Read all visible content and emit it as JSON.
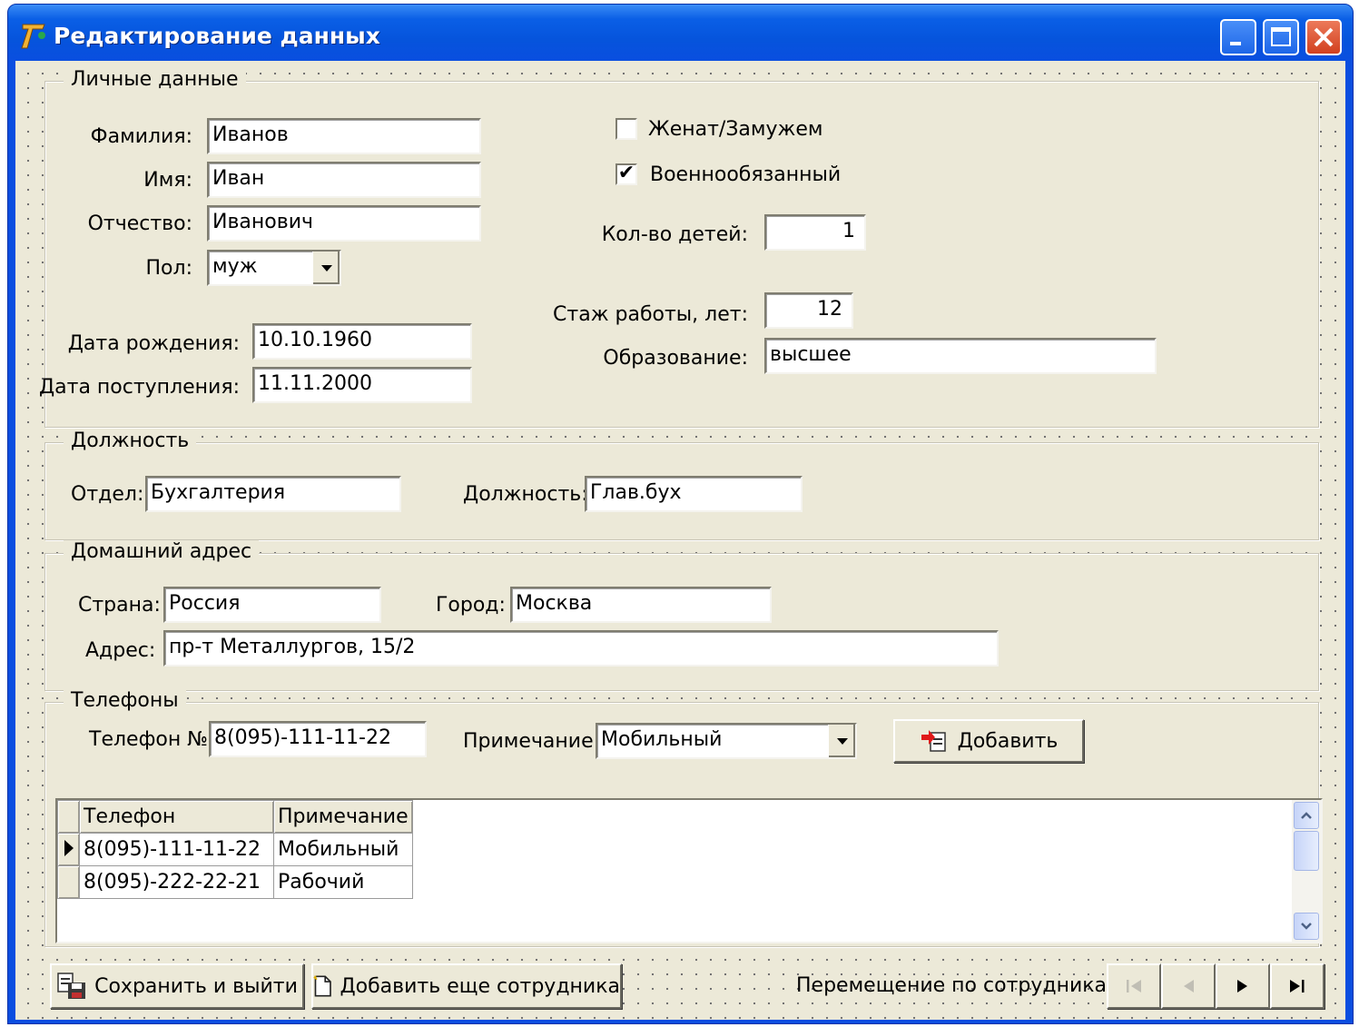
{
  "window": {
    "title": "Редактирование данных"
  },
  "personal": {
    "caption": "Личные данные",
    "last_name_label": "Фамилия:",
    "last_name": "Иванов",
    "first_name_label": "Имя:",
    "first_name": "Иван",
    "patronymic_label": "Отчество:",
    "patronymic": "Иванович",
    "sex_label": "Пол:",
    "sex": "муж",
    "birth_date_label": "Дата рождения:",
    "birth_date": "10.10.1960",
    "hire_date_label": "Дата поступления:",
    "hire_date": "11.11.2000",
    "married_label": "Женат/Замужем",
    "married_checked": false,
    "military_label": "Военнообязанный",
    "military_checked": true,
    "military_mark": "✔",
    "children_label": "Кол-во детей:",
    "children": "1",
    "experience_label": "Стаж работы, лет:",
    "experience": "12",
    "education_label": "Образование:",
    "education": "высшее"
  },
  "position": {
    "caption": "Должность",
    "department_label": "Отдел:",
    "department": "Бухгалтерия",
    "title_label": "Должность:",
    "title": "Глав.бух"
  },
  "address": {
    "caption": "Домашний адрес",
    "country_label": "Страна:",
    "country": "Россия",
    "city_label": "Город:",
    "city": "Москва",
    "street_label": "Адрес:",
    "street": "пр-т Металлургов, 15/2"
  },
  "phones": {
    "caption": "Телефоны",
    "phone_label": "Телефон №",
    "phone": "8(095)-111-11-22",
    "note_label": "Примечание:",
    "note": "Мобильный",
    "add_label": "Добавить",
    "columns": [
      "Телефон",
      "Примечание"
    ],
    "rows": [
      {
        "phone": "8(095)-111-11-22",
        "note": "Мобильный"
      },
      {
        "phone": "8(095)-222-22-21",
        "note": "Рабочий"
      }
    ]
  },
  "footer": {
    "save_label": "Сохранить и выйти",
    "add_employee_label": "Добавить еще сотрудника",
    "nav_label": "Перемещение по сотрудникам:"
  },
  "icons": {
    "app": "delphi-icon",
    "minimize": "minimize-icon",
    "maximize": "maximize-icon",
    "close": "close-icon",
    "combo": "chevron-down-icon",
    "first": "nav-first-icon",
    "prev": "nav-prev-icon",
    "next": "nav-next-icon",
    "last": "nav-last-icon"
  },
  "colors": {
    "titlebar": "#0a4ee0",
    "face": "#ece9d8",
    "close": "#d2401f"
  }
}
